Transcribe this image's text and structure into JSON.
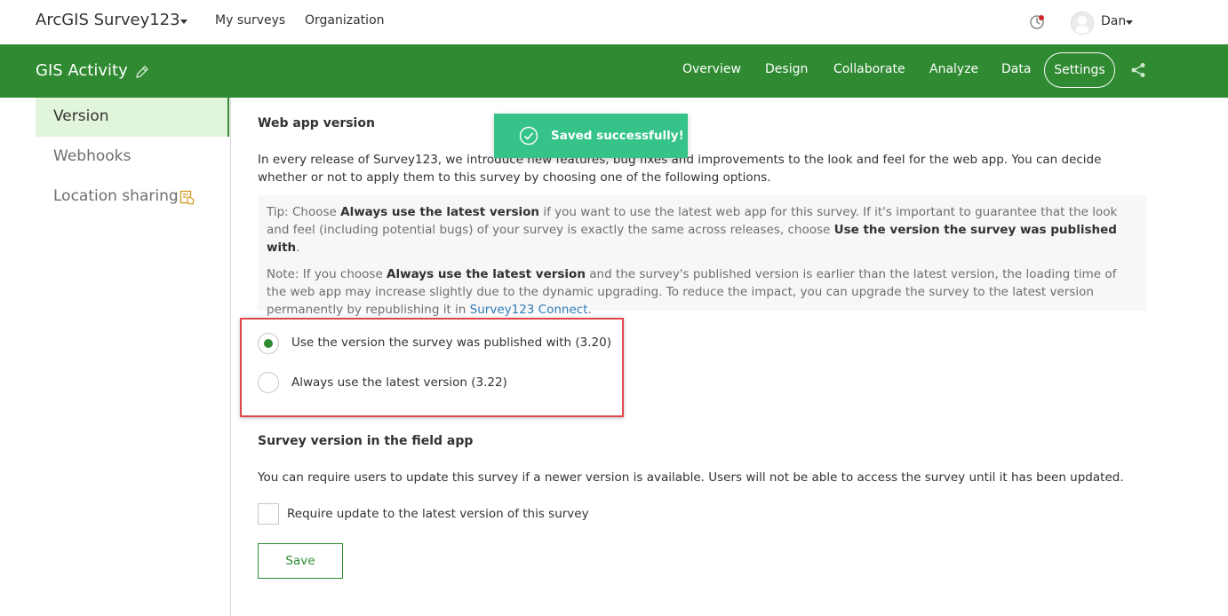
{
  "header": {
    "app_title": "ArcGIS Survey123",
    "nav": [
      "My surveys",
      "Organization"
    ],
    "user_name": "Dan"
  },
  "survey_bar": {
    "title": "GIS Activity",
    "tabs": [
      "Overview",
      "Design",
      "Collaborate",
      "Analyze",
      "Data"
    ],
    "settings_label": "Settings"
  },
  "sidebar": {
    "items": [
      {
        "label": "Version",
        "active": true
      },
      {
        "label": "Webhooks"
      },
      {
        "label": "Location sharing"
      }
    ]
  },
  "web_app_version": {
    "heading": "Web app version",
    "intro": "In every release of Survey123, we introduce new features, bug fixes and improvements to the look and feel for the web app. You can decide whether or not to apply them to this survey by choosing one of the following options.",
    "tip": {
      "prefix": "Tip: Choose ",
      "bold1": "Always use the latest version",
      "middle": " if you want to use the latest web app for this survey. If it's important to guarantee that the look and feel (including potential bugs) of your survey is exactly the same across releases, choose ",
      "bold2": "Use the version the survey was published with",
      "suffix": "."
    },
    "note": {
      "prefix": "Note: If you choose ",
      "bold": "Always use the latest version",
      "middle": " and the survey's published version is earlier than the latest version, the loading time of the web app may increase slightly due to the dynamic upgrading. To reduce the impact, you can upgrade the survey to the latest version permanently by republishing it in ",
      "link": "Survey123 Connect",
      "suffix": "."
    },
    "options": [
      {
        "label": "Use the version the survey was published with  (3.20)",
        "checked": true
      },
      {
        "label": "Always use the latest version  (3.22)",
        "checked": false
      }
    ]
  },
  "field_app_version": {
    "heading": "Survey version in the field app",
    "description": "You can require users to update this survey if a newer version is available. Users will not be able to access the survey until it has been updated.",
    "checkbox_label": "Require update to the latest version of this survey"
  },
  "save_label": "Save",
  "toast": {
    "message": "Saved successfully!",
    "color": "#35c38a"
  },
  "colors": {
    "brand_green": "#2f8a31",
    "highlight_red": "#e0474c",
    "link_blue": "#2f7ab6"
  }
}
